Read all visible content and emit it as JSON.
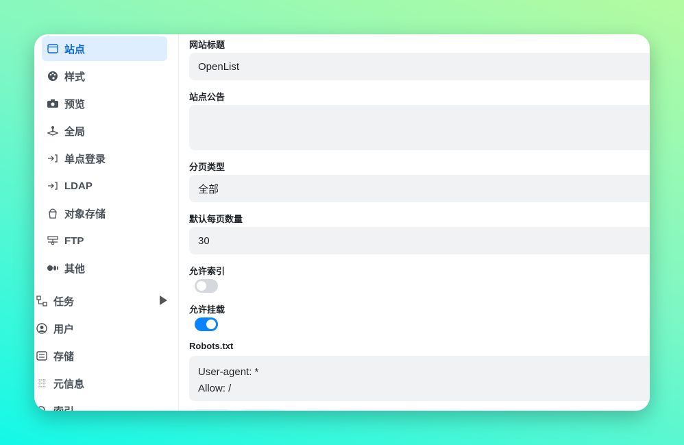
{
  "sidebar": {
    "sub_items": [
      {
        "label": "站点",
        "icon": "browser-window-icon",
        "active": true
      },
      {
        "label": "样式",
        "icon": "palette-icon"
      },
      {
        "label": "预览",
        "icon": "camera-icon"
      },
      {
        "label": "全局",
        "icon": "joystick-icon"
      },
      {
        "label": "单点登录",
        "icon": "login-icon"
      },
      {
        "label": "LDAP",
        "icon": "login-icon"
      },
      {
        "label": "对象存储",
        "icon": "bucket-icon"
      },
      {
        "label": "FTP",
        "icon": "network-icon"
      },
      {
        "label": "其他",
        "icon": "dots-icon"
      }
    ],
    "top_items": [
      {
        "label": "任务",
        "icon": "workflow-icon"
      },
      {
        "label": "用户",
        "icon": "user-circle-icon"
      },
      {
        "label": "存储",
        "icon": "storage-icon"
      },
      {
        "label": "元信息",
        "icon": "metadata-icon"
      },
      {
        "label": "索引",
        "icon": "search-icon"
      }
    ]
  },
  "form": {
    "site_title": {
      "label": "网站标题",
      "value": "OpenList"
    },
    "announcement": {
      "label": "站点公告",
      "value": ""
    },
    "pagination": {
      "label": "分页类型",
      "value": "全部"
    },
    "per_page": {
      "label": "默认每页数量",
      "value": "30"
    },
    "allow_indexed": {
      "label": "允许索引",
      "on": false
    },
    "allow_mounted": {
      "label": "允许挂载",
      "on": true
    },
    "robots": {
      "label": "Robots.txt",
      "line1": "User-agent: *",
      "line2": "Allow: /"
    }
  },
  "colors": {
    "accent": "#0a84ff",
    "active_bg": "#dfeeff",
    "toggle_off": "#d5d8dd"
  }
}
